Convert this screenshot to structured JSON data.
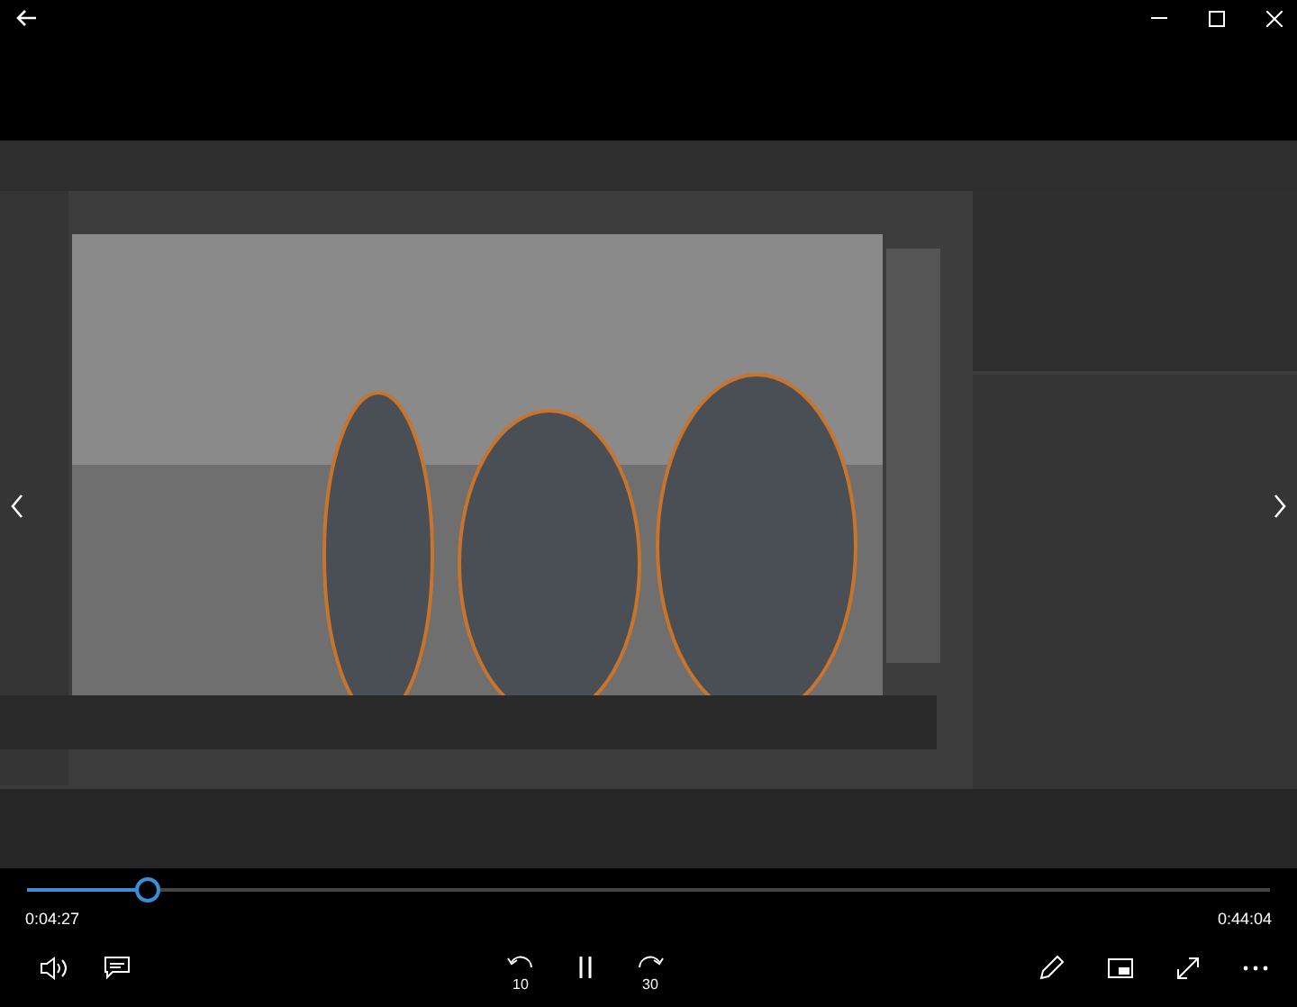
{
  "progress": {
    "level": 0.097
  },
  "elapsed": "0:04:27",
  "duration": "0:44:04",
  "playback": {
    "playing": true
  },
  "rewind_label": "10",
  "forward_label": "30"
}
